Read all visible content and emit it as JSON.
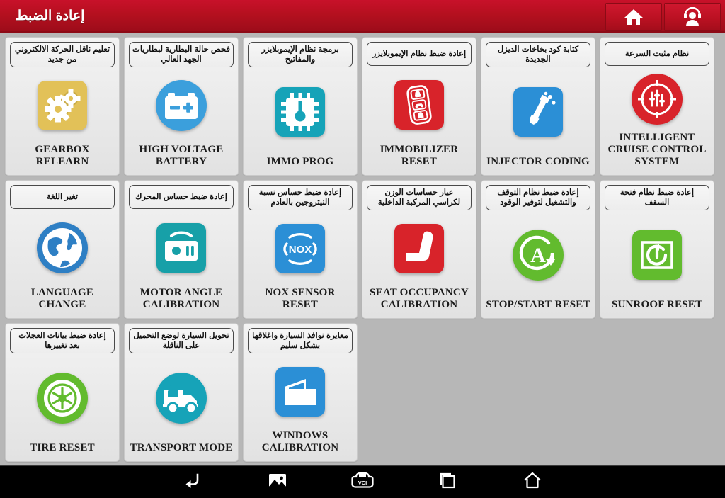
{
  "header": {
    "title": "إعادة الضبط",
    "buttons": [
      {
        "name": "home-button",
        "icon": "home-icon"
      },
      {
        "name": "support-button",
        "icon": "headset-user-icon"
      }
    ]
  },
  "grid": {
    "tiles": [
      {
        "arabic": "تعليم ناقل الحركة الالكتروني من جديد",
        "english": "GEARBOX\nRELEARN",
        "icon": "gears-icon",
        "icon_color": "#e2c158",
        "icon_shape": "square"
      },
      {
        "arabic": "فحص حالة البطارية لبطاريات الجهد العالي",
        "english": "HIGH VOLTAGE\nBATTERY",
        "icon": "battery-icon",
        "icon_color": "#3b9fdc",
        "icon_shape": "circle"
      },
      {
        "arabic": "برمجة نظام الإيموبلايزر والمفاتيح",
        "english": "IMMO PROG",
        "icon": "chip-key-icon",
        "icon_color": "#16a3b8",
        "icon_shape": "square"
      },
      {
        "arabic": "إعادة ضبط نظام الإيموبلايزر",
        "english": "IMMOBILIZER\nRESET",
        "icon": "key-fob-icon",
        "icon_color": "#d8232a",
        "icon_shape": "square"
      },
      {
        "arabic": "كتابة كود بخاخات الديزل الجديدة",
        "english": "INJECTOR CODING",
        "icon": "injector-icon",
        "icon_color": "#2b8fd6",
        "icon_shape": "square"
      },
      {
        "arabic": "نظام مثبت السرعة",
        "english": "INTELLIGENT\nCRUISE CONTROL\nSYSTEM",
        "icon": "cruise-control-icon",
        "icon_color": "#d8232a",
        "icon_shape": "circle"
      },
      {
        "arabic": "تغير اللغة",
        "english": "LANGUAGE\nCHANGE",
        "icon": "globe-icon",
        "icon_color": "#2e7fc4",
        "icon_shape": "circle"
      },
      {
        "arabic": "إعادة ضبط حساس المحرك",
        "english": "MOTOR ANGLE\nCALIBRATION",
        "icon": "motor-sensor-icon",
        "icon_color": "#17a0a8",
        "icon_shape": "square"
      },
      {
        "arabic": "إعادة ضبط حساس نسبة النيتروجين بالعادم",
        "english": "NOX SENSOR\nRESET",
        "icon": "nox-icon",
        "icon_color": "#2b8fd6",
        "icon_shape": "square"
      },
      {
        "arabic": "عيار حساسات الوزن لكراسي المركبة الداخلية",
        "english": "SEAT OCCUPANCY\nCALIBRATION",
        "icon": "car-seat-icon",
        "icon_color": "#d8232a",
        "icon_shape": "square"
      },
      {
        "arabic": "إعادة ضبط نظام التوقف والتشغيل لتوفير الوقود",
        "english": "STOP/START RESET",
        "icon": "auto-start-stop-icon",
        "icon_color": "#62bb2e",
        "icon_shape": "circle"
      },
      {
        "arabic": "إعادة ضبط نظام فتحة السقف",
        "english": "SUNROOF RESET",
        "icon": "sunroof-icon",
        "icon_color": "#62bb2e",
        "icon_shape": "square"
      },
      {
        "arabic": "إعادة ضبط بيانات العجلات بعد تغييرها",
        "english": "TIRE RESET",
        "icon": "tire-icon",
        "icon_color": "#62bb2e",
        "icon_shape": "circle"
      },
      {
        "arabic": "تحويل السيارة لوضع التحميل على الناقلة",
        "english": "TRANSPORT MODE",
        "icon": "truck-icon",
        "icon_color": "#16a3b8",
        "icon_shape": "circle"
      },
      {
        "arabic": "معايرة نوافذ السيارة واغلاقها بشكل سليم",
        "english": "WINDOWS\nCALIBRATION",
        "icon": "car-door-window-icon",
        "icon_color": "#2b8fd6",
        "icon_shape": "square"
      }
    ]
  },
  "navbar": {
    "buttons": [
      {
        "name": "back-button",
        "icon": "back-arrow-icon"
      },
      {
        "name": "screenshot-button",
        "icon": "image-icon"
      },
      {
        "name": "vci-button",
        "icon": "vci-connector-icon",
        "label": "VCI"
      },
      {
        "name": "recent-apps-button",
        "icon": "recent-apps-icon"
      },
      {
        "name": "home-nav-button",
        "icon": "home-outline-icon"
      }
    ]
  },
  "colors": {
    "header_red": "#b5101f",
    "page_background": "#b7b7b7",
    "tile_background": "#ececec",
    "navbar": "#000000"
  }
}
